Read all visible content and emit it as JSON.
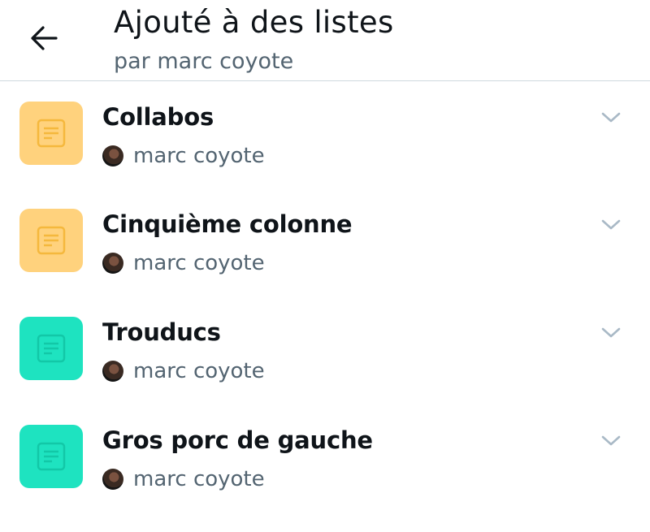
{
  "header": {
    "title": "Ajouté à des listes",
    "subtitle": "par marc coyote"
  },
  "colors": {
    "yellow_tile": "#ffd27d",
    "yellow_icon": "#f5b83d",
    "teal_tile": "#1ee3c0",
    "teal_icon": "#12c8a7",
    "secondary_text": "#536471",
    "chevron": "#a9b9c6"
  },
  "icons": {
    "back": "arrow-left-icon",
    "list": "list-document-icon",
    "expand": "chevron-down-icon"
  },
  "lists": [
    {
      "name": "Collabos",
      "owner": "marc coyote",
      "color": "yellow"
    },
    {
      "name": "Cinquième colonne",
      "owner": "marc coyote",
      "color": "yellow"
    },
    {
      "name": "Trouducs",
      "owner": "marc coyote",
      "color": "teal"
    },
    {
      "name": "Gros porc de gauche",
      "owner": "marc coyote",
      "color": "teal"
    }
  ]
}
